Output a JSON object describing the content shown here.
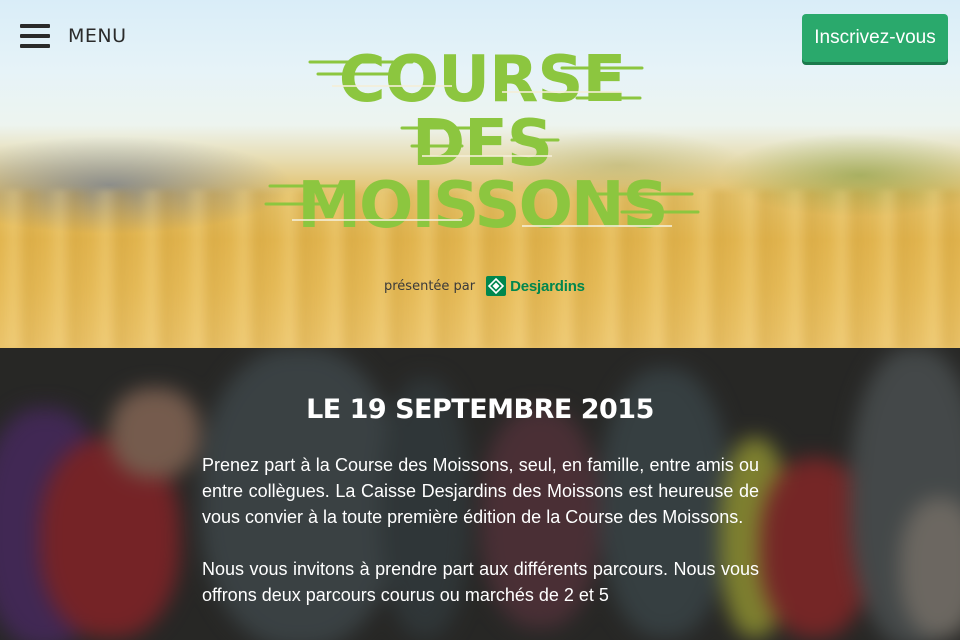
{
  "header": {
    "menu_label": "MENU",
    "signup_label": "Inscrivez-vous",
    "signup_color": "#2aa96c"
  },
  "logo": {
    "line1": "COURSE",
    "line2": "DES",
    "line3": "MOISSONS",
    "color": "#8cc63f"
  },
  "sponsor": {
    "presented_text": "présentée par",
    "name": "Desjardins",
    "color": "#00874e"
  },
  "info": {
    "date": "LE 19 SEPTEMBRE 2015",
    "paragraph1": "Prenez part à la Course des Moissons, seul, en famille, entre amis ou entre collègues. La Caisse Desjardins des Moissons est heureuse de vous convier à la toute première édition de la Course des Moissons.",
    "paragraph2": "Nous vous invitons à prendre part aux différents parcours. Nous vous offrons deux parcours courus ou marchés de 2 et 5"
  }
}
